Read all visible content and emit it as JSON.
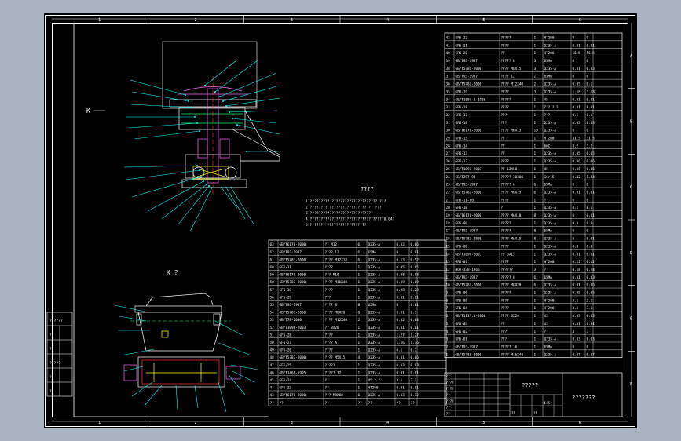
{
  "zones_top": [
    "1",
    "2",
    "3",
    "4",
    "5",
    "6"
  ],
  "zones_bottom": [
    "1",
    "2",
    "3",
    "4",
    "5",
    "6"
  ],
  "zones_right": [
    "A",
    "B",
    "C",
    "D",
    "E",
    "F"
  ],
  "view_label_side": "K",
  "view_label_bottom": "K ?",
  "section_note": "????",
  "tech_notes": [
    "1.????????? ????????????????????? ???",
    "2.???????? ????????????????? ?? ???   ",
    "3.?????????????????????????????",
    "4.??????????????????????????????????0.04?",
    "5.??????? ??????????????????"
  ],
  "left_block": [
    "??????",
    "??",
    "??",
    "?????",
    "??",
    "??"
  ],
  "bom_right": [
    [
      "42",
      "GF6-22",
      "?????",
      "1",
      "HT200",
      "9",
      "9"
    ],
    [
      "41",
      "GF6-21",
      "????",
      "1",
      "Q235-A",
      "0.01",
      "0.01"
    ],
    [
      "40",
      "GF6-20",
      "??",
      "1",
      "HT200",
      "56.5",
      "56.5"
    ],
    [
      "39",
      "GB/T93-1987",
      "????? 8",
      "3",
      "65Mn",
      "0",
      "0"
    ],
    [
      "38",
      "GB/T5781-2000",
      "???? M8X15",
      "3",
      "Q235-A",
      "0.01",
      "0.03"
    ],
    [
      "37",
      "GB/T93-1987",
      "???? 12",
      "2",
      "65Mn",
      "0",
      "0"
    ],
    [
      "36",
      "GB/T5781-2000",
      "???? M12X40",
      "2",
      "Q235-A",
      "0.05",
      "0.1"
    ],
    [
      "35",
      "GF6-19",
      "????",
      "3",
      "Q235-A",
      "1.18",
      "3.18"
    ],
    [
      "34",
      "GB/T1096-1-1986",
      "????? ",
      "1",
      "45",
      "0.01",
      "0.01"
    ],
    [
      "33",
      "GF6-18",
      "????",
      "1",
      "??? ?-2",
      "0.01",
      "0.01"
    ],
    [
      "32",
      "GF6-17",
      "???",
      "1",
      "???",
      "0.5",
      "0.5"
    ],
    [
      "31",
      "GF6-16",
      "???",
      "1",
      "Q235-A",
      "0.03",
      "0.03"
    ],
    [
      "30",
      "GB/T6170-2000",
      "???? M6X15",
      "10",
      "Q235-A",
      "0",
      "0"
    ],
    [
      "29",
      "GF6-15",
      "??",
      "1",
      "HT200",
      "31.5",
      "31.5"
    ],
    [
      "28",
      "GF6-14",
      "??",
      "1",
      "60Cr",
      "3.2",
      "3.2"
    ],
    [
      "27",
      "GF6-13",
      "??",
      "1",
      "Q235-A",
      "0.05",
      "0.05"
    ],
    [
      "26",
      "GF6-12",
      "????",
      "1",
      "Q235-A",
      "0.06",
      "0.06"
    ],
    [
      "25",
      "GB/T1096-2003",
      "?? 12X58",
      "1",
      "45",
      "0.06",
      "0.06"
    ],
    [
      "24",
      "GB/T297-94",
      "????? 30306",
      "1",
      "GCr15",
      "0.42",
      "1.44"
    ],
    [
      "23",
      "GB/T93-1987",
      "????? 6",
      "6",
      "65Mn",
      "0",
      "0"
    ],
    [
      "22",
      "GB/T5781-2000",
      "???? M6X25",
      "6",
      "Q235-A",
      "0.01",
      "0.01"
    ],
    [
      "21",
      "GF6-11-00",
      "????",
      "1",
      "??",
      "6",
      "6"
    ],
    [
      "20",
      "GF6-10",
      "?",
      "1",
      "Q235-A",
      "0.1",
      "0.1"
    ],
    [
      "19",
      "GB/T6170-2000",
      "???? M6X10",
      "8",
      "Q235-A",
      "0",
      "0.01"
    ],
    [
      "18",
      "GF6-09",
      "?????",
      "1",
      "Q235-A",
      "0.3",
      "0.3"
    ],
    [
      "17",
      "GB/T93-1987",
      "?????",
      "8",
      "65Mn",
      "0",
      "0"
    ],
    [
      "16",
      "GB/T5781-2000",
      "???? M6X15",
      "8",
      "Q235-A",
      "0",
      "0.01"
    ],
    [
      "15",
      "GF6-08",
      "????",
      "1",
      "Q235-A",
      "0.4",
      "0.4"
    ],
    [
      "14",
      "GB/T1096-2003",
      "?? 6X15",
      "1",
      "Q235-A",
      "0.01",
      "0.01"
    ],
    [
      "13",
      "GF6-07",
      "????",
      "1",
      "HT200",
      "0.12",
      "0.12"
    ],
    [
      "12",
      "HGA-338-1966",
      "??????",
      "3",
      "??",
      "0.18",
      "0.24"
    ],
    [
      "11",
      "GB/T93-1987",
      "????? 8",
      "6",
      "65Mn",
      "0.01",
      "0.03"
    ],
    [
      "10",
      "GB/T5781-2000",
      "???? M8X20",
      "6",
      "Q235-A",
      "0.01",
      "0.06"
    ],
    [
      "9",
      "GF6-06",
      "?????",
      "1",
      "Q235-A",
      "0.05",
      "0.05"
    ],
    [
      "8",
      "GF6-05",
      "????",
      "1",
      "HT200",
      "3.1",
      "3.1"
    ],
    [
      "7",
      "GF6-04",
      "????",
      "1",
      "HT200",
      "3.1",
      "3.1"
    ],
    [
      "6",
      "GB/T1117.1-2000",
      "???? 6X20",
      "1",
      "45",
      "0.03",
      "0.03"
    ],
    [
      "5",
      "GF6-03",
      "??",
      "1",
      "45",
      "0.31",
      "0.31"
    ],
    [
      "4",
      "GF6-02",
      "???",
      "1",
      "??",
      "3",
      "3"
    ],
    [
      "3",
      "GF6-01",
      "???",
      "1",
      "Q235-A",
      "0.03",
      "0.03"
    ],
    [
      "2",
      "GB/T93-1987",
      "????? 16",
      "1",
      "65Mn",
      "0",
      "0"
    ],
    [
      "1",
      "GB/T5783-2000",
      "???? M16X40",
      "1",
      "Q235-A",
      "0.07",
      "0.07"
    ]
  ],
  "bom_left": [
    [
      "63",
      "GB/T6170-2000",
      "?? M12",
      "6",
      "Q235-A",
      "0.02",
      "0.06"
    ],
    [
      "62",
      "GB/T93-1987",
      "???? 12",
      "6",
      "65Mn",
      "0",
      "0.01"
    ],
    [
      "61",
      "GB/T5783-2000",
      "???? M12X18",
      "6",
      "Q235-A",
      "0.13",
      "0.52"
    ],
    [
      "60",
      "GF6-31",
      "????",
      "1",
      "Q235-A",
      "0.05",
      "0.05"
    ],
    [
      "59",
      "GB/T6170-2000",
      "??? M16",
      "1",
      "Q235-A",
      "0.08",
      "0.08"
    ],
    [
      "58",
      "GB/T5781-2000",
      "???? M16X40",
      "1",
      "Q235-A",
      "0.09",
      "0.09"
    ],
    [
      "57",
      "GF6-30",
      "????",
      "1",
      "Q235-A",
      "0.28",
      "0.28"
    ],
    [
      "56",
      "GF6-29",
      "???",
      "1",
      "Q235-A",
      "0.01",
      "0.01"
    ],
    [
      "55",
      "GB/T93-1987",
      "???? 8",
      "8",
      "65Mn",
      "0",
      "0.01"
    ],
    [
      "54",
      "GB/T5781-2000",
      "???? M8X20",
      "8",
      "Q235-A",
      "0.01",
      "0.1"
    ],
    [
      "53",
      "GB/T78-2000",
      "???? M12X40",
      "2",
      "Q235-A",
      "0.02",
      "0.04"
    ],
    [
      "52",
      "GB/T1096-2003",
      "?? 8X28",
      "1",
      "Q235-A",
      "0.01",
      "0.01"
    ],
    [
      "51",
      "GF6-28",
      "????",
      "1",
      "Q235-A",
      "1.27",
      "1.27"
    ],
    [
      "50",
      "GF6-27",
      "???? A",
      "1",
      "Q235-A",
      "1.16",
      "1.16"
    ],
    [
      "49",
      "GF6-26",
      "????",
      "1",
      "Q235-A",
      "0.1",
      "0.7"
    ],
    [
      "48",
      "GB/T5783-2000",
      "???? M5X15",
      "4",
      "Q235-A",
      "0.01",
      "0.06"
    ],
    [
      "47",
      "GF6-25",
      "?????",
      "1",
      "Q235-A",
      "0.03",
      "0.03"
    ],
    [
      "46",
      "GB/T1460-1995",
      "????? 12",
      "1",
      "Q235-A",
      "0.01",
      "0.01"
    ],
    [
      "45",
      "GF6-24",
      "??",
      "1",
      "45 ? ?",
      "3.1",
      "3.1"
    ],
    [
      "44",
      "GF6-23",
      "??",
      "1",
      "HT200",
      "0.01",
      "0.01"
    ],
    [
      "43",
      "GB/T6170-2000",
      "??? M8X08",
      "6",
      "Q235-A",
      "0.03",
      "0.12"
    ]
  ],
  "bom_left_header": [
    "??",
    "??",
    "??",
    "??",
    "??",
    "??",
    "??"
  ],
  "title_block": {
    "drawing_name": "?????",
    "company": "???????",
    "mid_cells": [
      "??",
      "????",
      "????",
      "??",
      "????",
      "??",
      "??"
    ],
    "scale": "1:5",
    "sheet_a": "??",
    "sheet_b": "??"
  }
}
